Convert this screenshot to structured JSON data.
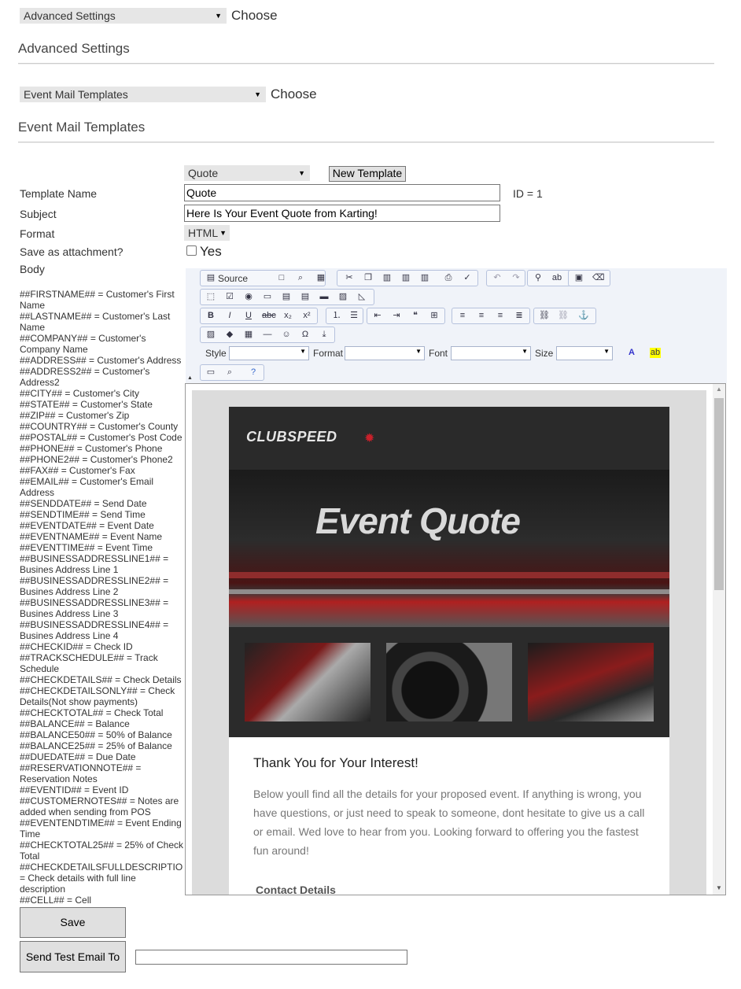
{
  "top_select": {
    "value": "Advanced Settings",
    "choose": "Choose"
  },
  "section1_title": "Advanced Settings",
  "second_select": {
    "value": "Event Mail Templates",
    "choose": "Choose"
  },
  "section2_title": "Event Mail Templates",
  "template_select": {
    "value": "Quote"
  },
  "new_template_button": "New Template",
  "form": {
    "template_name_label": "Template Name",
    "template_name_value": "Quote",
    "id_text": "ID = 1",
    "subject_label": "Subject",
    "subject_value": "Here Is Your Event Quote from Karting!",
    "format_label": "Format",
    "format_value": "HTML",
    "attachment_label": "Save as attachment?",
    "attachment_option": "Yes",
    "body_label": "Body"
  },
  "tokens": [
    "##FIRSTNAME## = Customer's First Name",
    "##LASTNAME## = Customer's Last Name",
    "##COMPANY## = Customer's Company Name",
    "##ADDRESS## = Customer's Address",
    "##ADDRESS2## = Customer's Address2",
    "##CITY## = Customer's City",
    "##STATE## = Customer's State",
    "##ZIP## = Customer's Zip",
    "##COUNTRY## = Customer's County",
    "##POSTAL## = Customer's Post Code",
    "##PHONE## = Customer's Phone",
    "##PHONE2## = Customer's Phone2",
    "##FAX## = Customer's Fax",
    "##EMAIL## = Customer's Email Address",
    "##SENDDATE## = Send Date",
    "##SENDTIME## = Send Time",
    "##EVENTDATE## = Event Date",
    "##EVENTNAME## = Event Name",
    "##EVENTTIME## = Event Time",
    "##BUSINESSADDRESSLINE1## = Busines Address Line 1",
    "##BUSINESSADDRESSLINE2## = Busines Address Line 2",
    "##BUSINESSADDRESSLINE3## = Busines Address Line 3",
    "##BUSINESSADDRESSLINE4## = Busines Address Line 4",
    "##CHECKID## = Check ID",
    "##TRACKSCHEDULE## = Track Schedule",
    "##CHECKDETAILS## = Check Details",
    "##CHECKDETAILSONLY## = Check Details(Not show payments)",
    "##CHECKTOTAL## = Check Total",
    "##BALANCE## = Balance",
    "##BALANCE50## = 50% of Balance",
    "##BALANCE25## = 25% of Balance",
    "##DUEDATE## = Due Date",
    "##RESERVATIONNOTE## = Reservation Notes",
    "##EVENTID## = Event ID",
    "##CUSTOMERNOTES## = Notes are added when sending from POS",
    "##EVENTENDTIME## = Event Ending Time",
    "##CHECKTOTAL25## = 25% of Check Total",
    "##CHECKDETAILSFULLDESCRIPTION## = Check details with full line description",
    "##CELL## = Cell"
  ],
  "toolbar": {
    "source_label": "Source",
    "style_label": "Style",
    "format_label": "Format",
    "font_label": "Font",
    "size_label": "Size"
  },
  "email": {
    "logo": "CLUBSPEED",
    "hero_title": "Event Quote",
    "heading": "Thank You for Your Interest!",
    "paragraph": "Below youll find all the details for your proposed event. If anything is wrong, you have questions, or just need to speak to someone, dont hesitate to give us a call or email. Wed love to hear from you. Looking forward to offering you the fastest fun around!",
    "contact_heading": "Contact Details"
  },
  "save_button": "Save",
  "send_test_button": "Send Test Email To",
  "send_test_value": ""
}
